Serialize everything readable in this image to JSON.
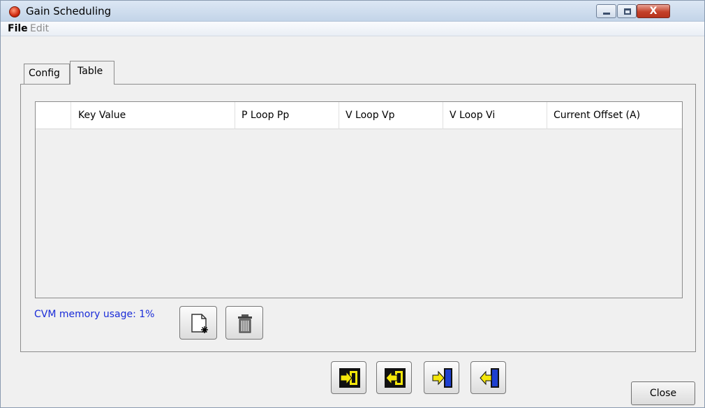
{
  "window": {
    "title": "Gain Scheduling",
    "caption_buttons": {
      "minimize_icon": "minimize-icon",
      "maximize_icon": "maximize-icon",
      "close_label": "X"
    }
  },
  "menu": {
    "file": "File",
    "edit": "Edit"
  },
  "tabs": [
    {
      "label": "Config",
      "active": false
    },
    {
      "label": "Table",
      "active": true
    }
  ],
  "table": {
    "columns": [
      "Key Value",
      "P Loop Pp",
      "V Loop Vp",
      "V Loop Vi",
      "Current Offset (A)"
    ],
    "rows": []
  },
  "memory_usage": "CVM memory usage: 1%",
  "tools": {
    "new_icon": "new-document-icon",
    "delete_icon": "trash-icon"
  },
  "nav_buttons": [
    {
      "icon": "import-to-panel-icon"
    },
    {
      "icon": "export-from-panel-icon"
    },
    {
      "icon": "import-to-device-icon"
    },
    {
      "icon": "export-from-device-icon"
    }
  ],
  "colors": {
    "accent_text": "#1a2cd8",
    "arrow_yellow": "#f5e70a",
    "device_blue": "#1d3fd0"
  },
  "close_button": "Close"
}
